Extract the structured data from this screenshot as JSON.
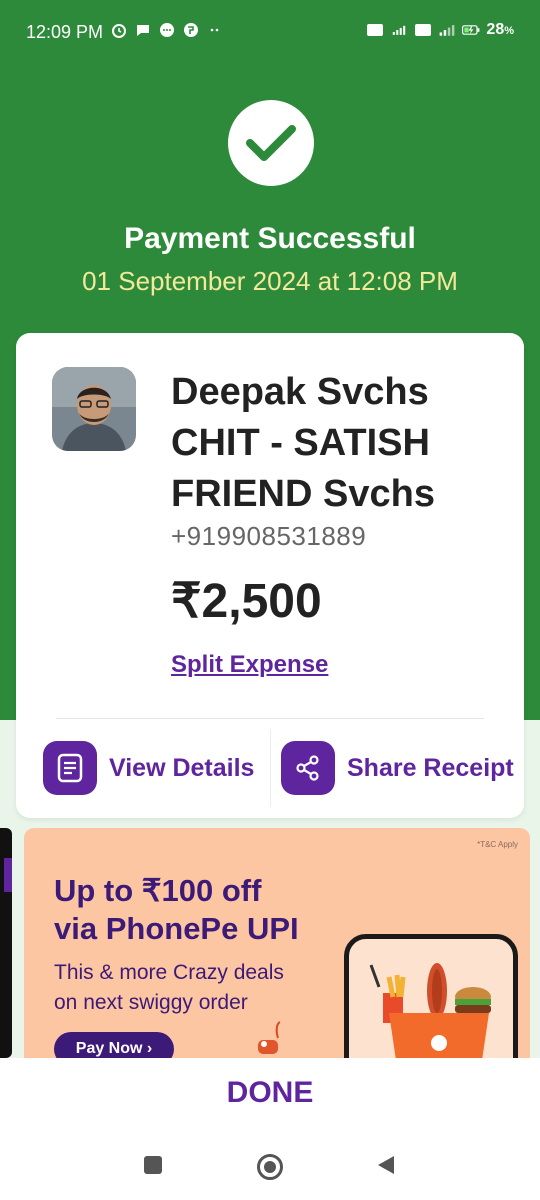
{
  "status_bar": {
    "time": "12:09 PM",
    "battery": "28"
  },
  "header": {
    "title": "Payment Successful",
    "date": "01 September 2024 at 12:08 PM"
  },
  "payee": {
    "name": "Deepak Svchs CHIT - SATISH FRIEND Svchs",
    "phone": "+919908531889",
    "amount": "₹2,500",
    "split_label": "Split Expense"
  },
  "actions": {
    "view_details": "View Details",
    "share_receipt": "Share Receipt"
  },
  "banner": {
    "tc": "*T&C Apply",
    "headline_line1": "Up to ₹100 off",
    "headline_line2": "via PhonePe UPI",
    "sub_line1": "This & more Crazy deals",
    "sub_line2": "on next swiggy order",
    "cta": "Pay Now ›"
  },
  "footer": {
    "done_label": "DONE"
  },
  "colors": {
    "header_green": "#2d8a3a",
    "brand_purple": "#5f259f",
    "date_yellow": "#f3e99a",
    "banner_peach": "#fdc6a2"
  }
}
